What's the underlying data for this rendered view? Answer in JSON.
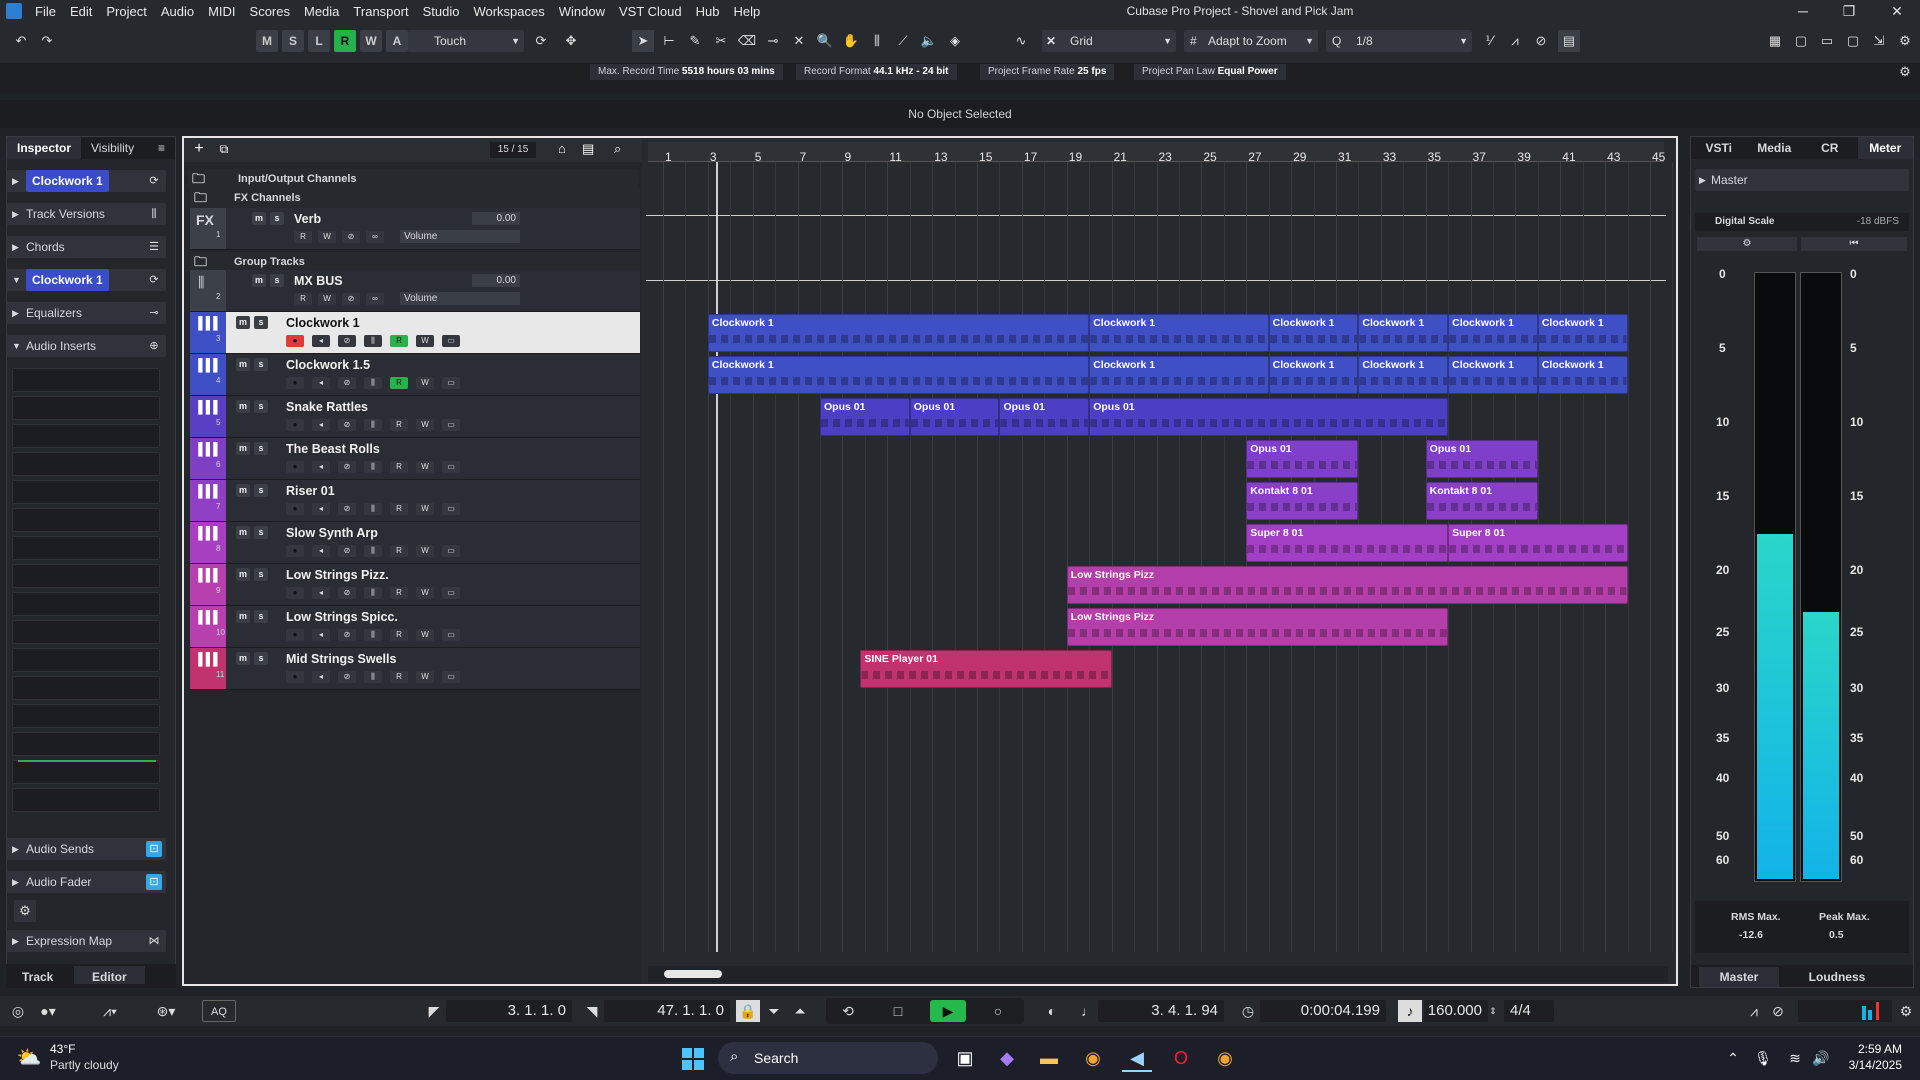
{
  "window": {
    "title": "Cubase Pro Project - Shovel and Pick Jam",
    "minimize": "─",
    "maximize": "❐",
    "close": "✕"
  },
  "menu": [
    "File",
    "Edit",
    "Project",
    "Audio",
    "MIDI",
    "Scores",
    "Media",
    "Transport",
    "Studio",
    "Workspaces",
    "Window",
    "VST Cloud",
    "Hub",
    "Help"
  ],
  "toolbar": {
    "undo": "↶",
    "redo": "↷",
    "states": [
      "M",
      "S",
      "L",
      "R",
      "W",
      "A"
    ],
    "automation_mode": "Touch",
    "snap_type": "Grid",
    "grid_type": "Adapt to Zoom",
    "quantize": "1/8"
  },
  "statusline": [
    {
      "label": "Max. Record Time",
      "value": "5518 hours 03 mins"
    },
    {
      "label": "Record Format",
      "value": "44.1 kHz - 24 bit"
    },
    {
      "label": "Project Frame Rate",
      "value": "25 fps"
    },
    {
      "label": "Project Pan Law",
      "value": "Equal Power"
    }
  ],
  "info_line": "No Object Selected",
  "inspector": {
    "tabs": [
      "Inspector",
      "Visibility"
    ],
    "sections": [
      {
        "label": "Clockwork 1",
        "highlight": true
      },
      {
        "label": "Track Versions"
      },
      {
        "label": "Chords"
      },
      {
        "label": "Clockwork 1",
        "highlight": true
      },
      {
        "label": "Equalizers"
      },
      {
        "label": "Audio Inserts"
      }
    ],
    "bottom_sections": [
      "Audio Sends",
      "Audio Fader",
      "Expression Map"
    ],
    "bottom_tabs": [
      "Track",
      "Editor"
    ]
  },
  "tracklist": {
    "counter": "15 / 15",
    "folders": [
      "Input/Output Channels",
      "FX Channels",
      "Group Tracks"
    ],
    "fx_tag": "FX",
    "channel_tracks": [
      {
        "num": "1",
        "name": "Verb",
        "value": "0.00",
        "param": "Volume"
      },
      {
        "num": "2",
        "name": "MX BUS",
        "value": "0.00",
        "param": "Volume"
      }
    ],
    "tracks": [
      {
        "num": "3",
        "name": "Clockwork 1",
        "color": "#3f4fc4"
      },
      {
        "num": "4",
        "name": "Clockwork 1.5",
        "color": "#3f4fc4"
      },
      {
        "num": "5",
        "name": "Snake Rattles",
        "color": "#5a3fc4"
      },
      {
        "num": "6",
        "name": "The Beast Rolls",
        "color": "#7f3fc4"
      },
      {
        "num": "7",
        "name": "Riser 01",
        "color": "#8f3fc4"
      },
      {
        "num": "8",
        "name": "Slow Synth Arp",
        "color": "#a83fc0"
      },
      {
        "num": "9",
        "name": "Low Strings Pizz.",
        "color": "#b83fae"
      },
      {
        "num": "10",
        "name": "Low Strings Spicc.",
        "color": "#b83fae"
      },
      {
        "num": "11",
        "name": "Mid Strings Swells",
        "color": "#c0336f"
      }
    ]
  },
  "ruler": [
    "1",
    "3",
    "5",
    "7",
    "9",
    "11",
    "13",
    "15",
    "17",
    "19",
    "21",
    "23",
    "25",
    "27",
    "29",
    "31",
    "33",
    "35",
    "37",
    "39",
    "41",
    "43",
    "45"
  ],
  "parts": [
    {
      "track": 0,
      "label": "Clockwork 1",
      "start": 3,
      "end": 20,
      "color": "#3f4fc4"
    },
    {
      "track": 0,
      "label": "Clockwork 1",
      "start": 20,
      "end": 28,
      "color": "#3f4fc4"
    },
    {
      "track": 0,
      "label": "Clockwork 1",
      "start": 28,
      "end": 32,
      "color": "#3f4fc4"
    },
    {
      "track": 0,
      "label": "Clockwork 1",
      "start": 32,
      "end": 36,
      "color": "#3f4fc4"
    },
    {
      "track": 0,
      "label": "Clockwork 1",
      "start": 36,
      "end": 40,
      "color": "#3f4fc4"
    },
    {
      "track": 0,
      "label": "Clockwork 1",
      "start": 40,
      "end": 44,
      "color": "#3f4fc4"
    },
    {
      "track": 1,
      "label": "Clockwork 1",
      "start": 3,
      "end": 20,
      "color": "#3f4fc4"
    },
    {
      "track": 1,
      "label": "Clockwork 1",
      "start": 20,
      "end": 28,
      "color": "#3f4fc4"
    },
    {
      "track": 1,
      "label": "Clockwork 1",
      "start": 28,
      "end": 32,
      "color": "#3f4fc4"
    },
    {
      "track": 1,
      "label": "Clockwork 1",
      "start": 32,
      "end": 36,
      "color": "#3f4fc4"
    },
    {
      "track": 1,
      "label": "Clockwork 1",
      "start": 36,
      "end": 40,
      "color": "#3f4fc4"
    },
    {
      "track": 1,
      "label": "Clockwork 1",
      "start": 40,
      "end": 44,
      "color": "#3f4fc4"
    },
    {
      "track": 2,
      "label": "Opus 01",
      "start": 8,
      "end": 12,
      "color": "#4d3fc4"
    },
    {
      "track": 2,
      "label": "Opus 01",
      "start": 12,
      "end": 16,
      "color": "#4d3fc4"
    },
    {
      "track": 2,
      "label": "Opus 01",
      "start": 16,
      "end": 20,
      "color": "#4d3fc4"
    },
    {
      "track": 2,
      "label": "Opus 01",
      "start": 20,
      "end": 36,
      "color": "#4d3fc4"
    },
    {
      "track": 3,
      "label": "Opus 01",
      "start": 27,
      "end": 32,
      "color": "#7f3fc8"
    },
    {
      "track": 3,
      "label": "Opus 01",
      "start": 35,
      "end": 40,
      "color": "#7f3fc8"
    },
    {
      "track": 4,
      "label": "Kontakt 8 01",
      "start": 27,
      "end": 32,
      "color": "#8a3fc8"
    },
    {
      "track": 4,
      "label": "Kontakt 8 01",
      "start": 35,
      "end": 40,
      "color": "#8a3fc8"
    },
    {
      "track": 5,
      "label": "Super 8 01",
      "start": 27,
      "end": 36,
      "color": "#a33fc4"
    },
    {
      "track": 5,
      "label": "Super 8 01",
      "start": 36,
      "end": 44,
      "color": "#a33fc4"
    },
    {
      "track": 6,
      "label": "Low Strings Pizz",
      "start": 19,
      "end": 44,
      "color": "#b53faa"
    },
    {
      "track": 7,
      "label": "Low Strings Pizz",
      "start": 19,
      "end": 36,
      "color": "#b53faa"
    },
    {
      "track": 8,
      "label": "SINE Player 01",
      "start": 9.8,
      "end": 21,
      "color": "#c0336f"
    }
  ],
  "right_zone": {
    "tabs": [
      "VSTi",
      "Media",
      "CR",
      "Meter"
    ],
    "master": "Master",
    "scale_label": "Digital Scale",
    "scale_value": "-18 dBFS",
    "scale": [
      "0",
      "5",
      "10",
      "15",
      "20",
      "25",
      "30",
      "35",
      "40",
      "50",
      "60"
    ],
    "rms_label": "RMS Max.",
    "rms_value": "-12.6",
    "peak_label": "Peak Max.",
    "peak_value": "0.5",
    "bottom_tabs": [
      "Master",
      "Loudness"
    ],
    "meter_left_level": 0.57,
    "meter_right_level": 0.44
  },
  "transport": {
    "left_locator": "3. 1. 1. 0",
    "right_locator": "47. 1. 1. 0",
    "position": "3. 4. 1. 94",
    "time": "0:00:04.199",
    "tempo": "160.000",
    "signature": "4/4",
    "aq": "AQ"
  },
  "taskbar": {
    "weather_temp": "43°F",
    "weather_desc": "Partly cloudy",
    "search": "Search",
    "time": "2:59 AM",
    "date": "3/14/2025"
  }
}
